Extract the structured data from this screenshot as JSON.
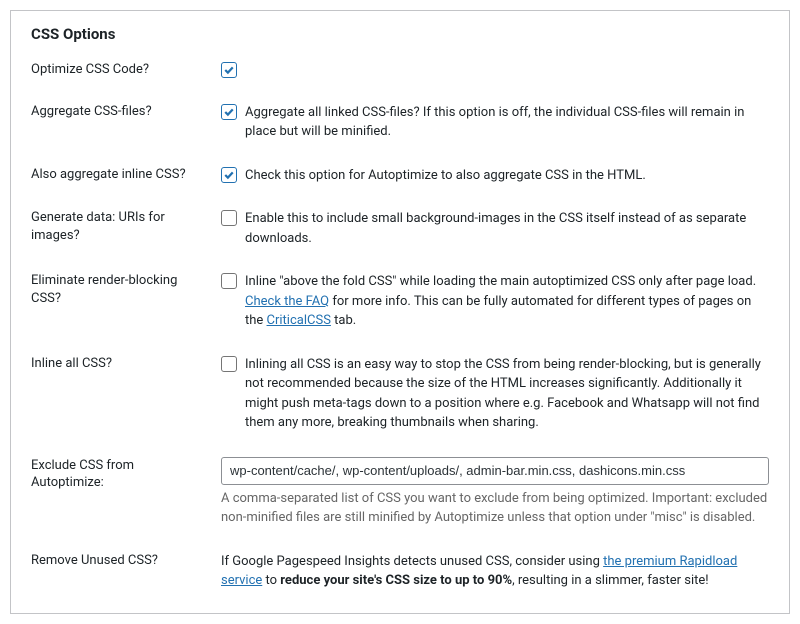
{
  "title": "CSS Options",
  "rows": {
    "optimize": {
      "label": "Optimize CSS Code?",
      "checked": true
    },
    "aggregate": {
      "label": "Aggregate CSS-files?",
      "checked": true,
      "desc": "Aggregate all linked CSS-files? If this option is off, the individual CSS-files will remain in place but will be minified."
    },
    "inlinecss": {
      "label": "Also aggregate inline CSS?",
      "checked": true,
      "desc": "Check this option for Autoptimize to also aggregate CSS in the HTML."
    },
    "datauri": {
      "label": "Generate data: URIs for images?",
      "checked": false,
      "desc": "Enable this to include small background-images in the CSS itself instead of as separate downloads."
    },
    "renderblock": {
      "label": "Eliminate render-blocking CSS?",
      "checked": false,
      "desc_pre": "Inline \"above the fold CSS\" while loading the main autoptimized CSS only after page load. ",
      "link1": "Check the FAQ",
      "desc_mid": " for more info. This can be fully automated for different types of pages on the ",
      "link2": "CriticalCSS",
      "desc_post": " tab."
    },
    "inlineall": {
      "label": "Inline all CSS?",
      "checked": false,
      "desc": "Inlining all CSS is an easy way to stop the CSS from being render-blocking, but is generally not recommended because the size of the HTML increases significantly. Additionally it might push meta-tags down to a position where e.g. Facebook and Whatsapp will not find them any more, breaking thumbnails when sharing."
    },
    "exclude": {
      "label": "Exclude CSS from Autoptimize:",
      "value": "wp-content/cache/, wp-content/uploads/, admin-bar.min.css, dashicons.min.css",
      "help": "A comma-separated list of CSS you want to exclude from being optimized. Important: excluded non-minified files are still minified by Autoptimize unless that option under \"misc\" is disabled."
    },
    "removeunused": {
      "label": "Remove Unused CSS?",
      "desc_pre": "If Google Pagespeed Insights detects unused CSS, consider using ",
      "link": "the premium Rapidload service",
      "desc_mid": " to ",
      "strong": "reduce your site's CSS size to up to 90%",
      "desc_post": ", resulting in a slimmer, faster site!"
    }
  }
}
